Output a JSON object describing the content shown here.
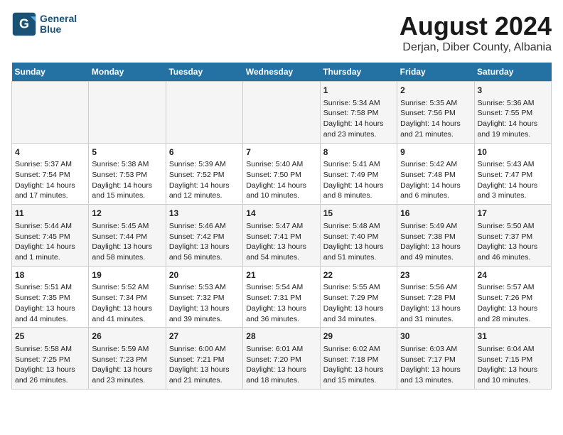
{
  "header": {
    "title": "August 2024",
    "subtitle": "Derjan, Diber County, Albania",
    "logo_line1": "General",
    "logo_line2": "Blue"
  },
  "days_of_week": [
    "Sunday",
    "Monday",
    "Tuesday",
    "Wednesday",
    "Thursday",
    "Friday",
    "Saturday"
  ],
  "weeks": [
    [
      {
        "day": "",
        "info": ""
      },
      {
        "day": "",
        "info": ""
      },
      {
        "day": "",
        "info": ""
      },
      {
        "day": "",
        "info": ""
      },
      {
        "day": "1",
        "info": "Sunrise: 5:34 AM\nSunset: 7:58 PM\nDaylight: 14 hours\nand 23 minutes."
      },
      {
        "day": "2",
        "info": "Sunrise: 5:35 AM\nSunset: 7:56 PM\nDaylight: 14 hours\nand 21 minutes."
      },
      {
        "day": "3",
        "info": "Sunrise: 5:36 AM\nSunset: 7:55 PM\nDaylight: 14 hours\nand 19 minutes."
      }
    ],
    [
      {
        "day": "4",
        "info": "Sunrise: 5:37 AM\nSunset: 7:54 PM\nDaylight: 14 hours\nand 17 minutes."
      },
      {
        "day": "5",
        "info": "Sunrise: 5:38 AM\nSunset: 7:53 PM\nDaylight: 14 hours\nand 15 minutes."
      },
      {
        "day": "6",
        "info": "Sunrise: 5:39 AM\nSunset: 7:52 PM\nDaylight: 14 hours\nand 12 minutes."
      },
      {
        "day": "7",
        "info": "Sunrise: 5:40 AM\nSunset: 7:50 PM\nDaylight: 14 hours\nand 10 minutes."
      },
      {
        "day": "8",
        "info": "Sunrise: 5:41 AM\nSunset: 7:49 PM\nDaylight: 14 hours\nand 8 minutes."
      },
      {
        "day": "9",
        "info": "Sunrise: 5:42 AM\nSunset: 7:48 PM\nDaylight: 14 hours\nand 6 minutes."
      },
      {
        "day": "10",
        "info": "Sunrise: 5:43 AM\nSunset: 7:47 PM\nDaylight: 14 hours\nand 3 minutes."
      }
    ],
    [
      {
        "day": "11",
        "info": "Sunrise: 5:44 AM\nSunset: 7:45 PM\nDaylight: 14 hours\nand 1 minute."
      },
      {
        "day": "12",
        "info": "Sunrise: 5:45 AM\nSunset: 7:44 PM\nDaylight: 13 hours\nand 58 minutes."
      },
      {
        "day": "13",
        "info": "Sunrise: 5:46 AM\nSunset: 7:42 PM\nDaylight: 13 hours\nand 56 minutes."
      },
      {
        "day": "14",
        "info": "Sunrise: 5:47 AM\nSunset: 7:41 PM\nDaylight: 13 hours\nand 54 minutes."
      },
      {
        "day": "15",
        "info": "Sunrise: 5:48 AM\nSunset: 7:40 PM\nDaylight: 13 hours\nand 51 minutes."
      },
      {
        "day": "16",
        "info": "Sunrise: 5:49 AM\nSunset: 7:38 PM\nDaylight: 13 hours\nand 49 minutes."
      },
      {
        "day": "17",
        "info": "Sunrise: 5:50 AM\nSunset: 7:37 PM\nDaylight: 13 hours\nand 46 minutes."
      }
    ],
    [
      {
        "day": "18",
        "info": "Sunrise: 5:51 AM\nSunset: 7:35 PM\nDaylight: 13 hours\nand 44 minutes."
      },
      {
        "day": "19",
        "info": "Sunrise: 5:52 AM\nSunset: 7:34 PM\nDaylight: 13 hours\nand 41 minutes."
      },
      {
        "day": "20",
        "info": "Sunrise: 5:53 AM\nSunset: 7:32 PM\nDaylight: 13 hours\nand 39 minutes."
      },
      {
        "day": "21",
        "info": "Sunrise: 5:54 AM\nSunset: 7:31 PM\nDaylight: 13 hours\nand 36 minutes."
      },
      {
        "day": "22",
        "info": "Sunrise: 5:55 AM\nSunset: 7:29 PM\nDaylight: 13 hours\nand 34 minutes."
      },
      {
        "day": "23",
        "info": "Sunrise: 5:56 AM\nSunset: 7:28 PM\nDaylight: 13 hours\nand 31 minutes."
      },
      {
        "day": "24",
        "info": "Sunrise: 5:57 AM\nSunset: 7:26 PM\nDaylight: 13 hours\nand 28 minutes."
      }
    ],
    [
      {
        "day": "25",
        "info": "Sunrise: 5:58 AM\nSunset: 7:25 PM\nDaylight: 13 hours\nand 26 minutes."
      },
      {
        "day": "26",
        "info": "Sunrise: 5:59 AM\nSunset: 7:23 PM\nDaylight: 13 hours\nand 23 minutes."
      },
      {
        "day": "27",
        "info": "Sunrise: 6:00 AM\nSunset: 7:21 PM\nDaylight: 13 hours\nand 21 minutes."
      },
      {
        "day": "28",
        "info": "Sunrise: 6:01 AM\nSunset: 7:20 PM\nDaylight: 13 hours\nand 18 minutes."
      },
      {
        "day": "29",
        "info": "Sunrise: 6:02 AM\nSunset: 7:18 PM\nDaylight: 13 hours\nand 15 minutes."
      },
      {
        "day": "30",
        "info": "Sunrise: 6:03 AM\nSunset: 7:17 PM\nDaylight: 13 hours\nand 13 minutes."
      },
      {
        "day": "31",
        "info": "Sunrise: 6:04 AM\nSunset: 7:15 PM\nDaylight: 13 hours\nand 10 minutes."
      }
    ]
  ]
}
